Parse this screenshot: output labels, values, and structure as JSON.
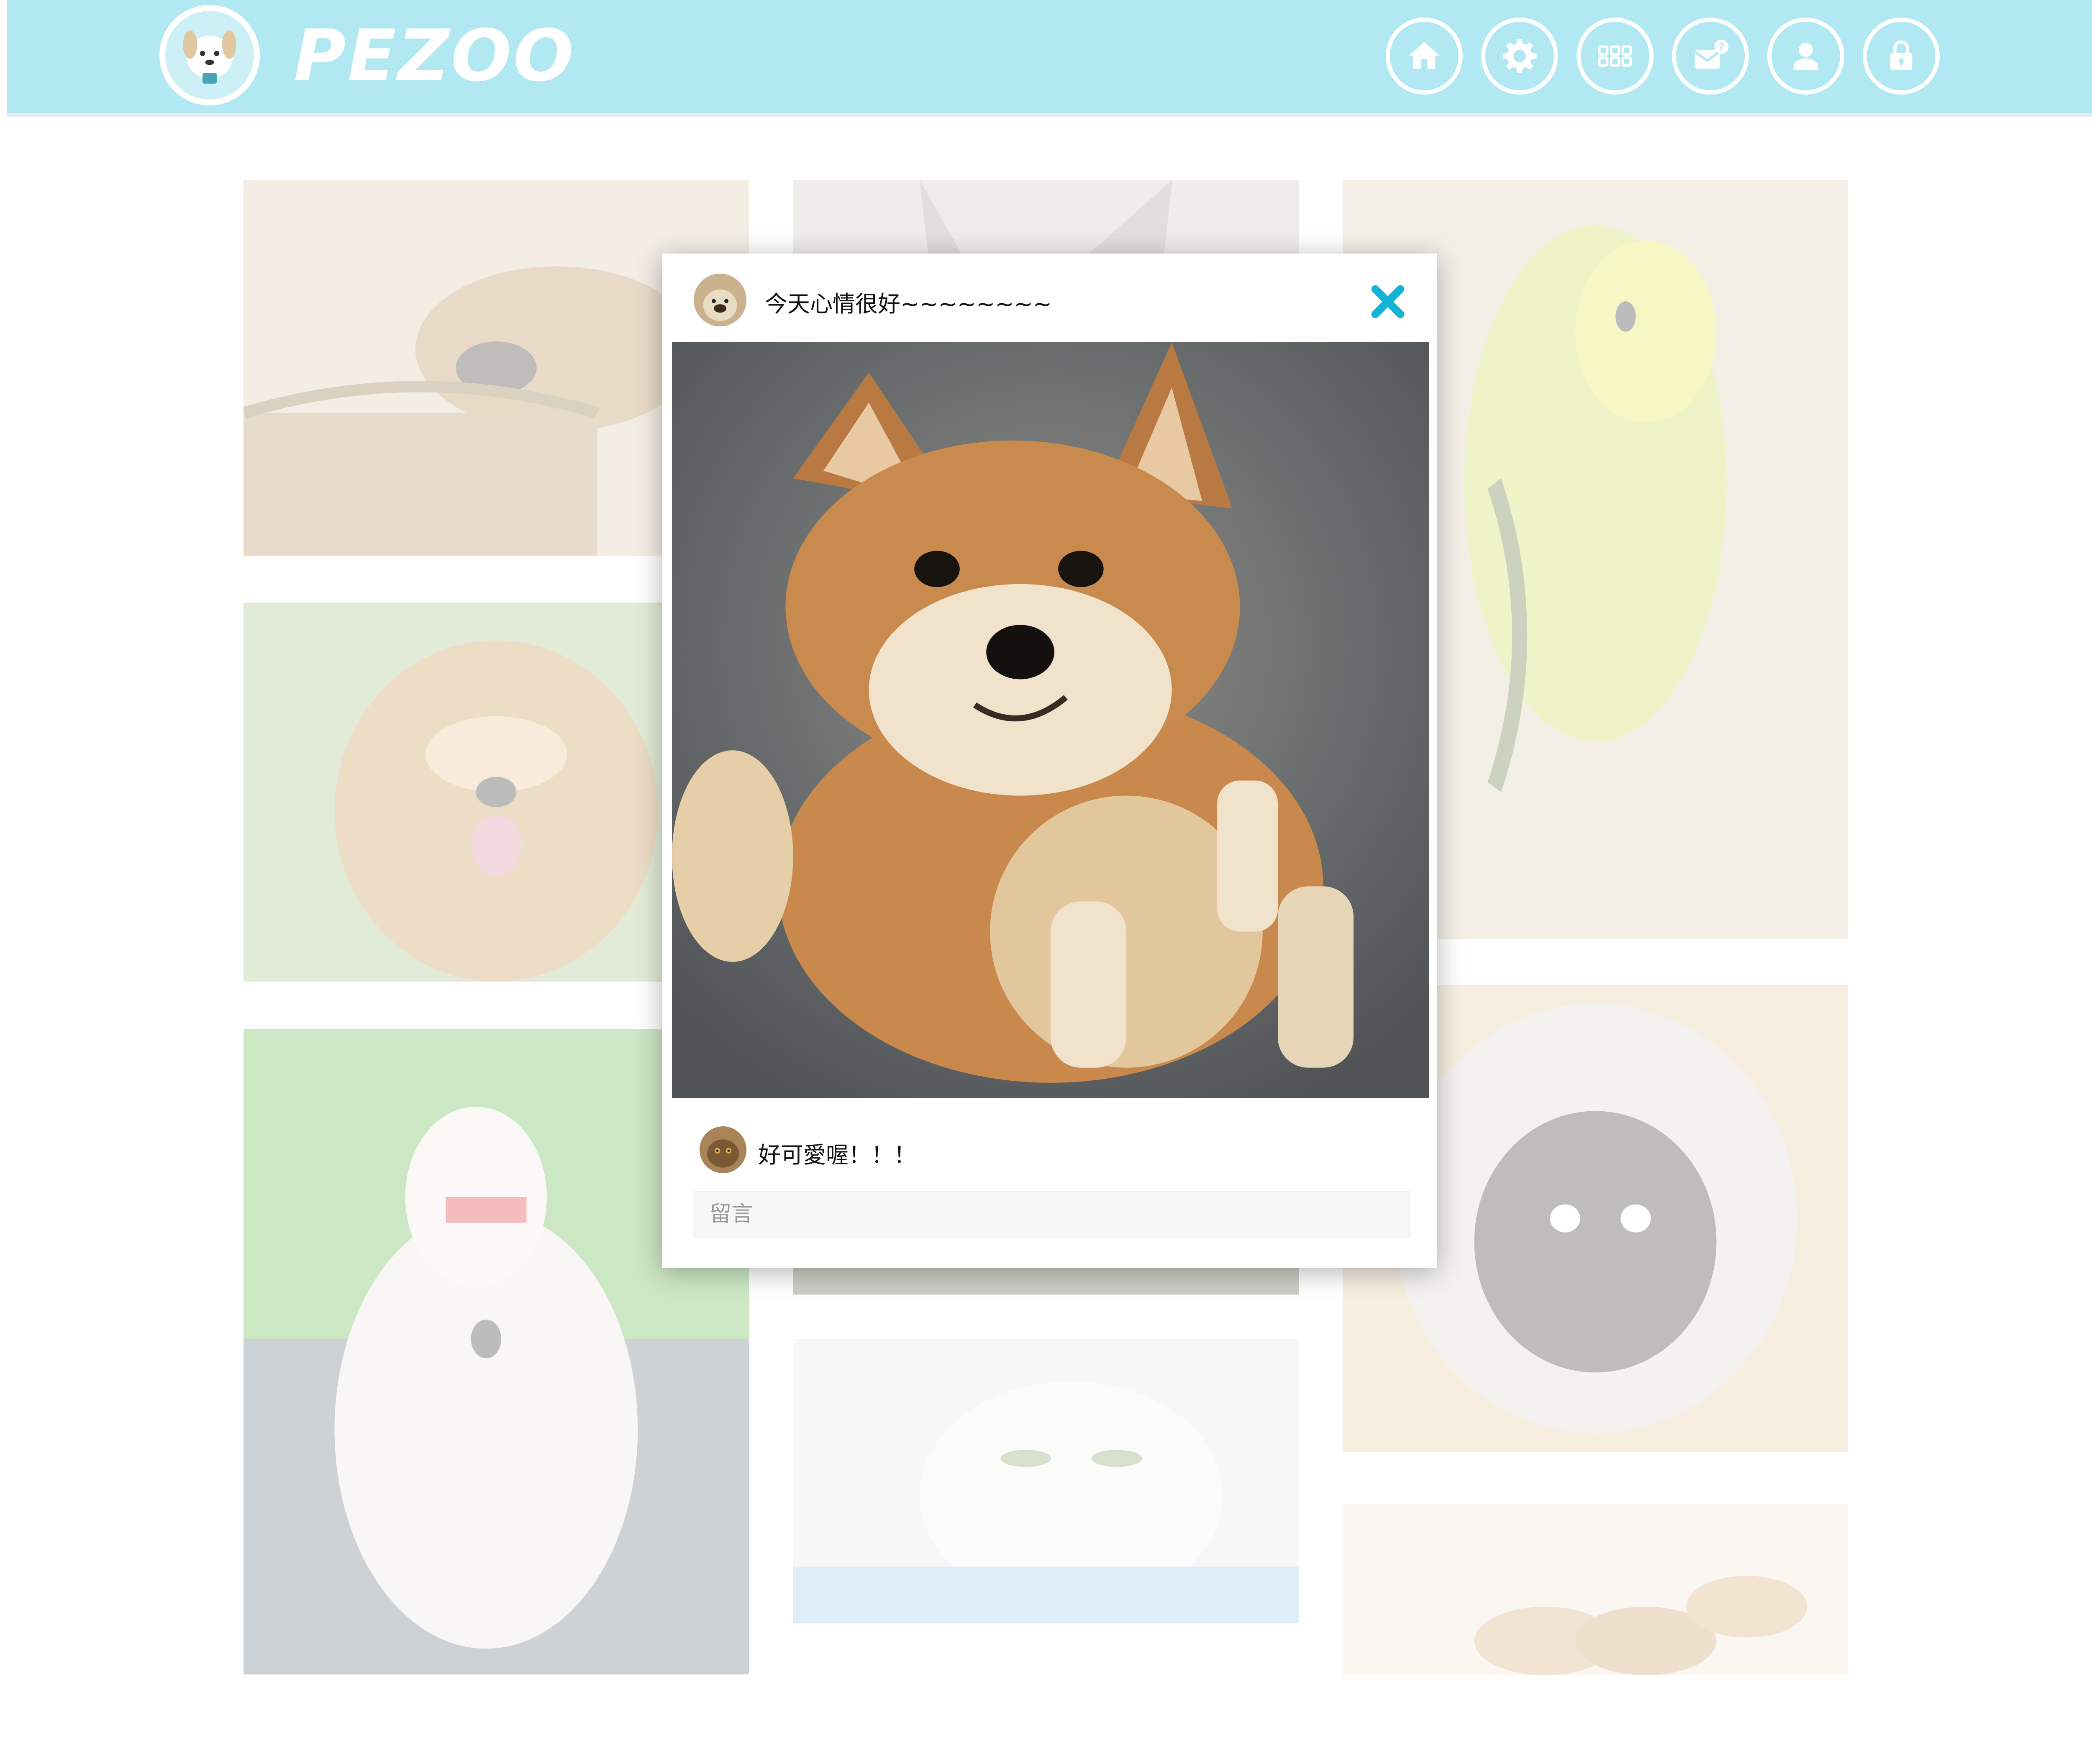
{
  "header": {
    "brand": "PEZOO",
    "nav": [
      {
        "id": "home",
        "icon": "home-icon"
      },
      {
        "id": "settings",
        "icon": "gear-icon"
      },
      {
        "id": "apps",
        "icon": "grid-icon"
      },
      {
        "id": "messages",
        "icon": "mail-question-icon"
      },
      {
        "id": "profile",
        "icon": "user-icon"
      },
      {
        "id": "lock",
        "icon": "lock-icon"
      }
    ],
    "accent": "#b1e8f1"
  },
  "post": {
    "caption": "今天心情很好~~~~~~~~",
    "comment": "好可愛喔！！！",
    "comment_placeholder": "留言",
    "close_color": "#11b5d6"
  },
  "gallery": [
    {
      "subject": "puppy sleeping in basket"
    },
    {
      "subject": "cat"
    },
    {
      "subject": "yellow budgie"
    },
    {
      "subject": "golden retriever"
    },
    {
      "subject": "shih tzu"
    },
    {
      "subject": "dog"
    },
    {
      "subject": "chihuahua with cone"
    },
    {
      "subject": "persian cat"
    },
    {
      "subject": "puppies"
    }
  ]
}
